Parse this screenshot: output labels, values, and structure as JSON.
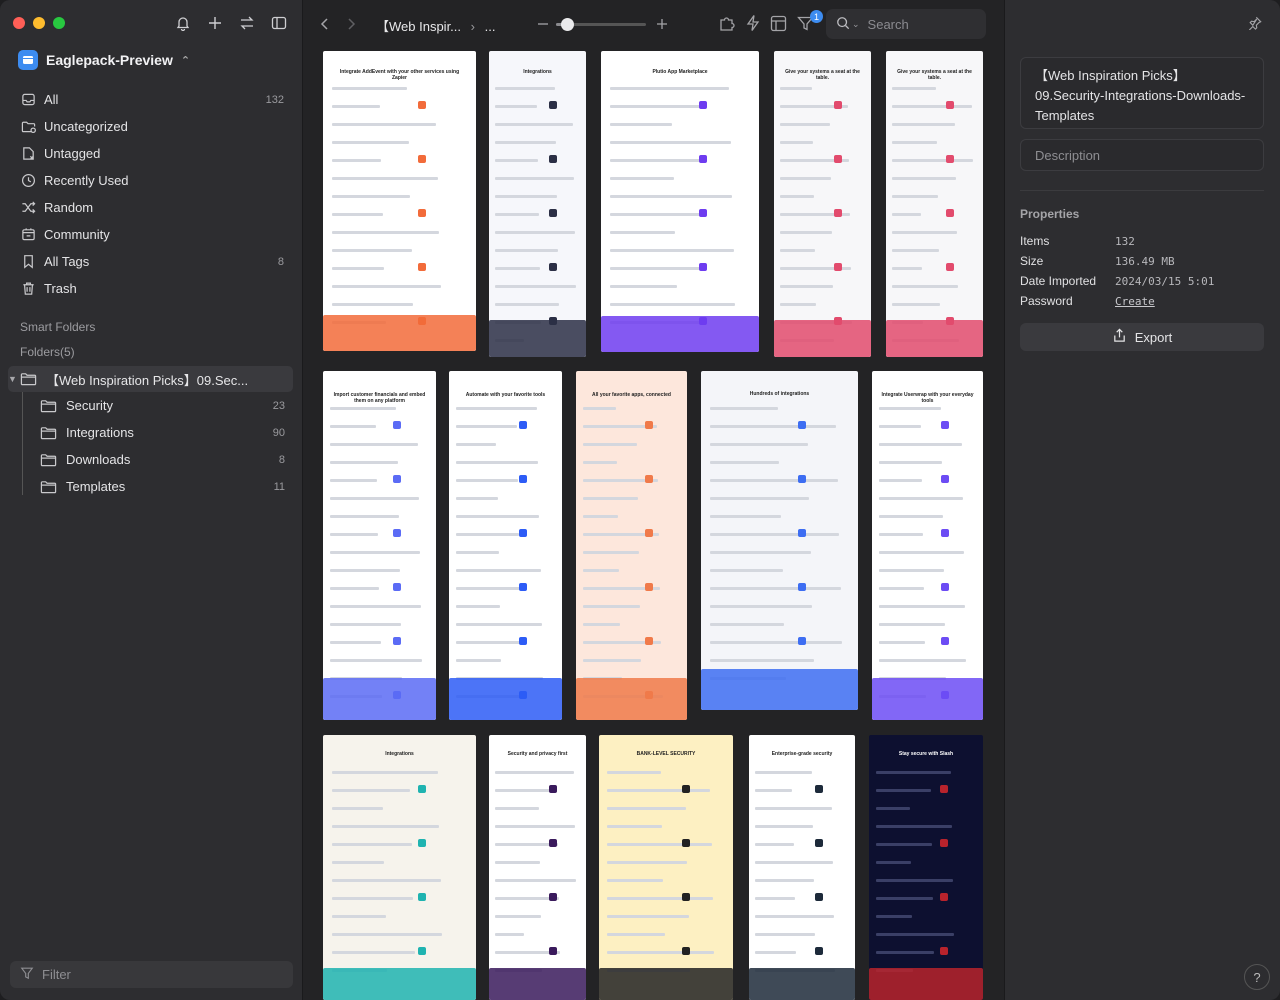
{
  "library": {
    "name": "Eaglepack-Preview"
  },
  "nav": [
    {
      "label": "All",
      "count": "132",
      "icon": "inbox-icon"
    },
    {
      "label": "Uncategorized",
      "count": "",
      "icon": "folder-question-icon"
    },
    {
      "label": "Untagged",
      "count": "",
      "icon": "tag-off-icon"
    },
    {
      "label": "Recently Used",
      "count": "",
      "icon": "clock-icon"
    },
    {
      "label": "Random",
      "count": "",
      "icon": "shuffle-icon"
    },
    {
      "label": "Community",
      "count": "",
      "icon": "community-icon"
    },
    {
      "label": "All Tags",
      "count": "8",
      "icon": "bookmark-icon"
    },
    {
      "label": "Trash",
      "count": "",
      "icon": "trash-icon"
    }
  ],
  "sections": {
    "smart_folders": "Smart Folders",
    "folders": "Folders(5)"
  },
  "folders": {
    "root": "【Web Inspiration Picks】09.Sec...",
    "children": [
      {
        "label": "Security",
        "count": "23"
      },
      {
        "label": "Integrations",
        "count": "90"
      },
      {
        "label": "Downloads",
        "count": "8"
      },
      {
        "label": "Templates",
        "count": "11"
      }
    ]
  },
  "filter": {
    "placeholder": "Filter"
  },
  "toolbar": {
    "breadcrumb": "【Web Inspir...",
    "breadcrumb_more": "...",
    "search_placeholder": "Search",
    "filter_badge": "1",
    "zoom_level": 0.12
  },
  "inspector": {
    "title": "【Web Inspiration Picks】09.Security-Integrations-Downloads-Templates",
    "description_placeholder": "Description",
    "properties_title": "Properties",
    "properties": [
      {
        "key": "Items",
        "value": "132"
      },
      {
        "key": "Size",
        "value": "136.49 MB"
      },
      {
        "key": "Date Imported",
        "value": "2024/03/15 5:01"
      },
      {
        "key": "Password",
        "value": "Create"
      }
    ],
    "export_label": "Export",
    "help_label": "?"
  },
  "thumbnails": [
    {
      "name": "addevent-integrations",
      "heading": "Integrate AddEvent with your other services using Zapier",
      "accent": "#f26b3a",
      "bg": "#ffffff"
    },
    {
      "name": "integrations-list-dark-footer",
      "heading": "Integrations",
      "accent": "#2b2f45",
      "bg": "#f6f7fb"
    },
    {
      "name": "plutio-app-marketplace",
      "heading": "Plutio App Marketplace",
      "accent": "#6e3cf0",
      "bg": "#ffffff"
    },
    {
      "name": "collaboration-integrations-a",
      "heading": "Give your systems a seat at the table.",
      "accent": "#e24b6d",
      "bg": "#f7f7f9"
    },
    {
      "name": "collaboration-integrations-b",
      "heading": "Give your systems a seat at the table.",
      "accent": "#e24b6d",
      "bg": "#f7f7f9"
    },
    {
      "name": "import-customer-financials",
      "heading": "Import customer financials and embed them on any platform",
      "accent": "#5b6bf5",
      "bg": "#ffffff"
    },
    {
      "name": "automate-favorite-tools",
      "heading": "Automate with your favorite tools",
      "accent": "#2d5cf6",
      "bg": "#ffffff"
    },
    {
      "name": "all-your-favorite-apps",
      "heading": "All your favorite apps, connected",
      "accent": "#f07a4a",
      "bg": "#fde7dc"
    },
    {
      "name": "hundreds-of-integrations",
      "heading": "Hundreds of integrations",
      "accent": "#3d6df2",
      "bg": "#f4f5f9"
    },
    {
      "name": "integrate-userwrap",
      "heading": "Integrate Userwrap with your everyday tools",
      "accent": "#6c4cf4",
      "bg": "#ffffff"
    },
    {
      "name": "supercharge-your-erp",
      "heading": "Integrations",
      "accent": "#1fb3b0",
      "bg": "#f6f3ec"
    },
    {
      "name": "security-privacy-first",
      "heading": "Security and privacy first",
      "accent": "#3a1a5c",
      "bg": "#ffffff"
    },
    {
      "name": "bank-level-security",
      "heading": "BANK-LEVEL SECURITY",
      "accent": "#222222",
      "bg": "#fdf0c2"
    },
    {
      "name": "enterprise-grade-security",
      "heading": "Enterprise-grade security",
      "accent": "#1d2a3a",
      "bg": "#ffffff"
    },
    {
      "name": "stay-secure-with-slash",
      "heading": "Stay secure with Slash",
      "accent": "#b8232c",
      "bg": "#0d1030"
    }
  ]
}
